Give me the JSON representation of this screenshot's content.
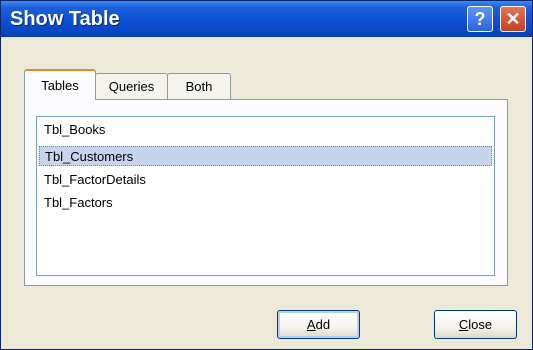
{
  "window": {
    "title": "Show Table"
  },
  "titlebar": {
    "help_glyph": "?",
    "close_glyph": "✕"
  },
  "tabs": [
    {
      "label": "Tables",
      "active": true
    },
    {
      "label": "Queries",
      "active": false
    },
    {
      "label": "Both",
      "active": false
    }
  ],
  "list": {
    "items": [
      {
        "label": "Tbl_Books",
        "selected": false
      },
      {
        "label": "Tbl_Customers",
        "selected": true
      },
      {
        "label": "Tbl_FactorDetails",
        "selected": false
      },
      {
        "label": "Tbl_Factors",
        "selected": false
      }
    ]
  },
  "buttons": {
    "add_label": "Add",
    "add_mnemonic": "A",
    "add_rest": "dd",
    "close_label": "Close",
    "close_mnemonic": "C",
    "close_rest": "lose"
  },
  "colors": {
    "titlebar": "#0b4fd4",
    "selection": "#c8d4ec",
    "dialog_bg": "#ece9d8",
    "close_button": "#c4401f"
  },
  "icons": {
    "help": "help-icon",
    "close": "close-icon"
  }
}
